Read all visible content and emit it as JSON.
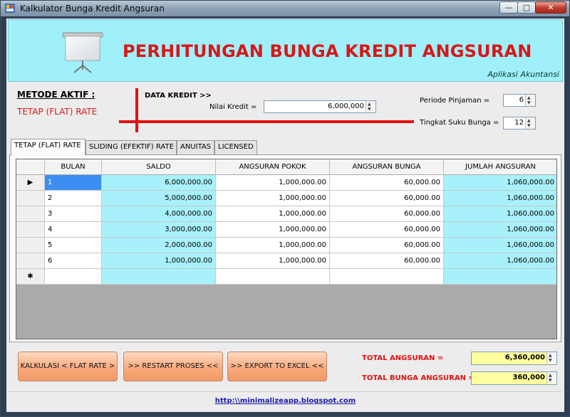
{
  "window": {
    "title": "Kalkulator Bunga Kredit Angsuran",
    "controls": {
      "minimize": "—",
      "maximize": "□",
      "close": "✕"
    }
  },
  "header": {
    "title": "PERHITUNGAN BUNGA KREDIT ANGSURAN",
    "subtitle": "Aplikasi Akuntansi",
    "icon": "projector-screen-icon"
  },
  "settings": {
    "metode_label": "METODE AKTIF :",
    "metode_value": "TETAP (FLAT) RATE",
    "data_kredit_label": "DATA KREDIT >>",
    "nilai_kredit_label": "Nilai Kredit =",
    "nilai_kredit_value": "6,000,000",
    "periode_label": "Periode Pinjaman =",
    "periode_value": "6",
    "suku_bunga_label": "Tingkat Suku Bunga =",
    "suku_bunga_value": "12"
  },
  "tabs": [
    {
      "label": "TETAP (FLAT) RATE",
      "active": true
    },
    {
      "label": "SLIDING (EFEKTIF) RATE",
      "active": false
    },
    {
      "label": "ANUITAS",
      "active": false
    },
    {
      "label": "LICENSED",
      "active": false
    }
  ],
  "grid": {
    "columns": [
      "BULAN",
      "SALDO",
      "ANGSURAN POKOK",
      "ANGSURAN BUNGA",
      "JUMLAH ANGSURAN"
    ],
    "current_row_marker": "▶",
    "new_row_marker": "✱",
    "rows": [
      [
        "1",
        "6,000,000.00",
        "1,000,000.00",
        "60,000.00",
        "1,060,000.00"
      ],
      [
        "2",
        "5,000,000.00",
        "1,000,000.00",
        "60,000.00",
        "1,060,000.00"
      ],
      [
        "3",
        "4,000,000.00",
        "1,000,000.00",
        "60,000.00",
        "1,060,000.00"
      ],
      [
        "4",
        "3,000,000.00",
        "1,000,000.00",
        "60,000.00",
        "1,060,000.00"
      ],
      [
        "5",
        "2,000,000.00",
        "1,000,000.00",
        "60,000.00",
        "1,060,000.00"
      ],
      [
        "6",
        "1,000,000.00",
        "1,000,000.00",
        "60,000.00",
        "1,060,000.00"
      ]
    ],
    "colors": {
      "accent_cells": "#a8f1fa",
      "selected": "#3c8ef3",
      "empty_area": "#aaaaaa"
    }
  },
  "buttons": {
    "kalkulasi": "KALKULASI < FLAT RATE >",
    "restart": ">> RESTART PROSES <<",
    "export": ">> EXPORT TO EXCEL <<"
  },
  "totals": {
    "total_angsuran_label": "TOTAL ANGSURAN =",
    "total_angsuran_value": "6,360,000",
    "total_bunga_label": "TOTAL BUNGA ANGSURAN =",
    "total_bunga_value": "360,000"
  },
  "footer": {
    "link": "http:\\\\minimalizeapp.blogspot.com"
  },
  "colors": {
    "header_bg": "#9ff0fb",
    "title_red": "#d81818",
    "button_orange": "#f6a77a",
    "total_box_yellow": "#ffffa0"
  }
}
